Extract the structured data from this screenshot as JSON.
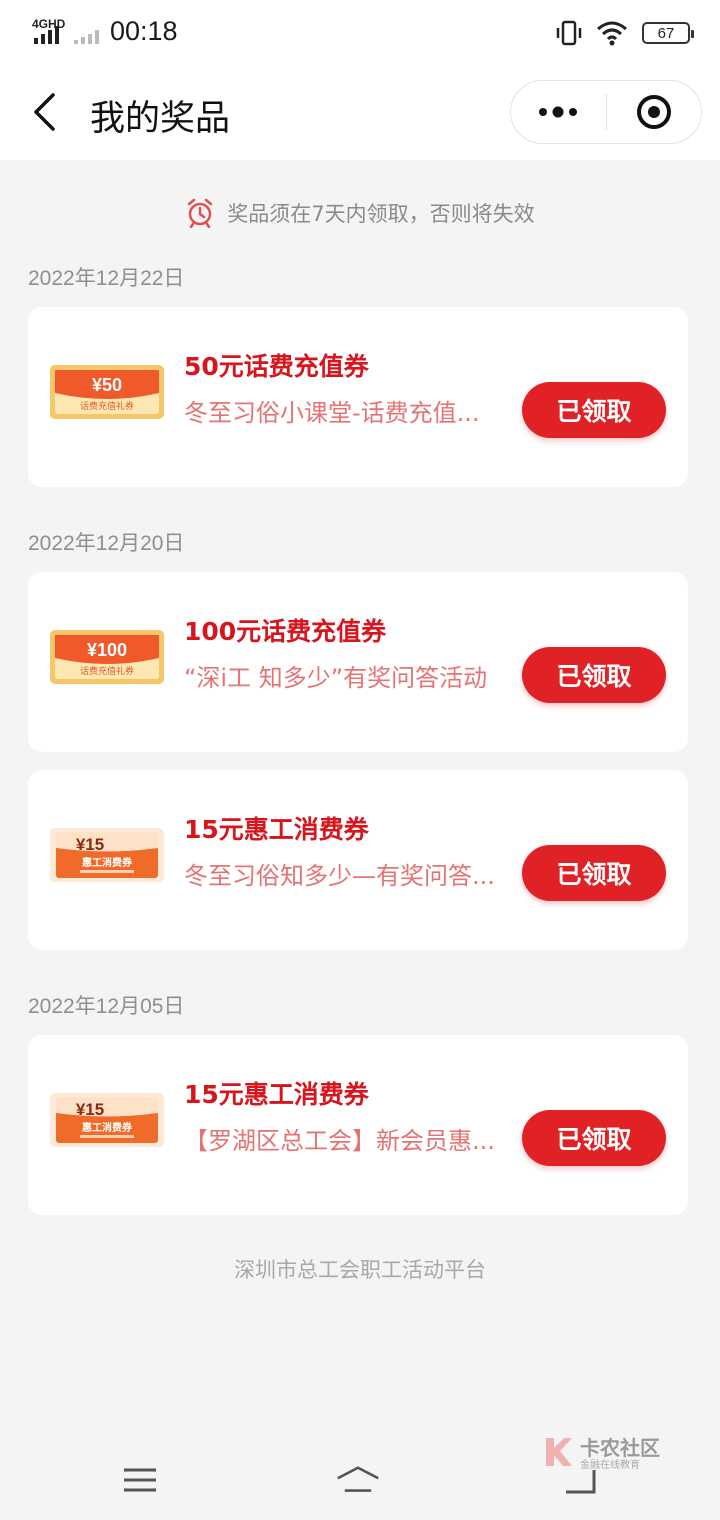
{
  "status_bar": {
    "network": "4GHD",
    "time": "00:18",
    "battery": "67",
    "icons": [
      "signal-icon",
      "vibrate-icon",
      "wifi-icon",
      "battery-icon"
    ]
  },
  "nav": {
    "title": "我的奖品",
    "icons": [
      "back-arrow-icon",
      "more-dots-icon",
      "close-target-icon"
    ]
  },
  "notice": {
    "icon": "alarm-clock-icon",
    "text": "奖品须在7天内领取，否则将失效"
  },
  "groups": [
    {
      "date": "2022年12月22日",
      "items": [
        {
          "title": "50元话费充值券",
          "subtitle": "冬至习俗小课堂-话费充值...",
          "button": "已领取",
          "coupon": {
            "amount": "¥50",
            "caption": "话费充值礼券"
          }
        }
      ]
    },
    {
      "date": "2022年12月20日",
      "items": [
        {
          "title": "100元话费充值券",
          "subtitle": "“深i工 知多少”有奖问答活动",
          "button": "已领取",
          "coupon": {
            "amount": "¥100",
            "caption": "话费充值礼券"
          }
        },
        {
          "title": "15元惠工消费券",
          "subtitle": "冬至习俗知多少—有奖问答...",
          "button": "已领取",
          "coupon": {
            "amount": "¥15",
            "caption": "惠工消费券"
          }
        }
      ]
    },
    {
      "date": "2022年12月05日",
      "items": [
        {
          "title": "15元惠工消费券",
          "subtitle": "【罗湖区总工会】新会员惠...",
          "button": "已领取",
          "coupon": {
            "amount": "¥15",
            "caption": "惠工消费券"
          }
        }
      ]
    }
  ],
  "footer": "深圳市总工会职工活动平台",
  "watermark": {
    "title": "卡农社区",
    "subtitle": "金融在线教育"
  },
  "system_nav": [
    "menu-icon",
    "home-icon",
    "back-icon"
  ],
  "colors": {
    "accent": "#e02125",
    "title_red": "#d8141c",
    "subtitle_red": "#e57373",
    "background": "#f4f4f4"
  }
}
